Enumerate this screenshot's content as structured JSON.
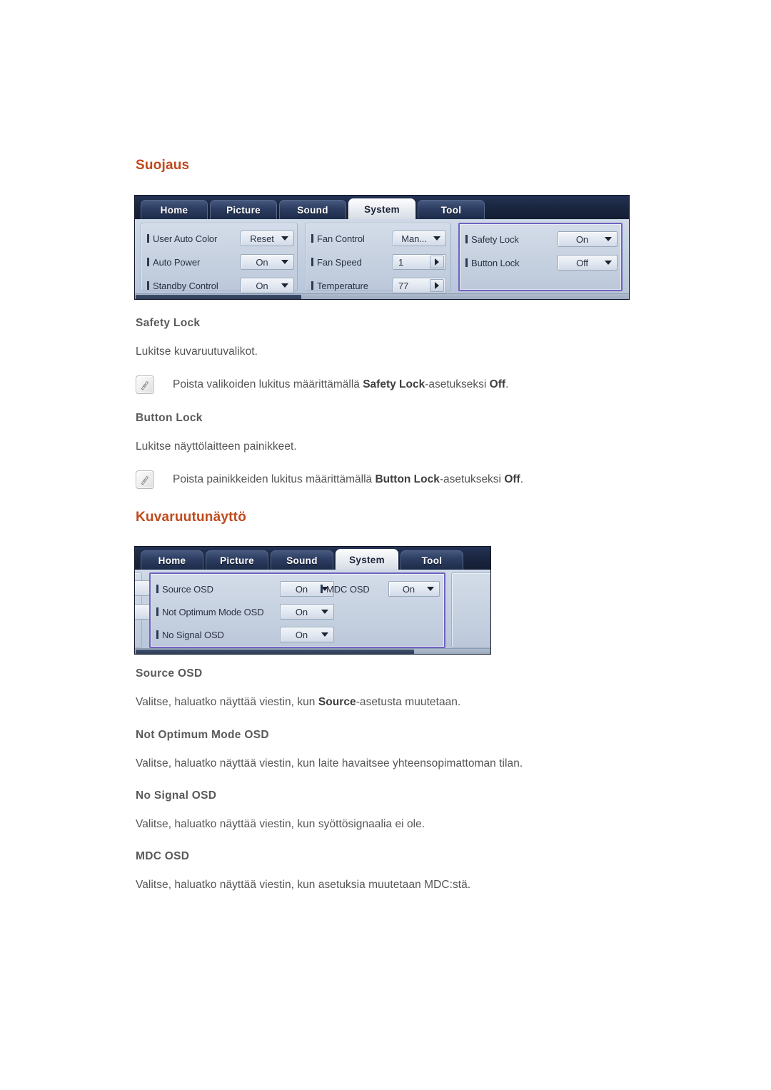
{
  "sections": [
    {
      "id": "suojaus",
      "heading": "Suojaus",
      "subsections": [
        {
          "title": "Safety Lock",
          "body": "Lukitse kuvaruutuvalikot.",
          "note_prefix": "Poista valikoiden lukitus määrittämällä ",
          "note_bold1": "Safety Lock",
          "note_mid": "-asetukseksi ",
          "note_bold2": "Off",
          "note_suffix": "."
        },
        {
          "title": "Button Lock",
          "body": "Lukitse näyttölaitteen painikkeet.",
          "note_prefix": "Poista painikkeiden lukitus määrittämällä ",
          "note_bold1": "Button Lock",
          "note_mid": "-asetukseksi ",
          "note_bold2": "Off",
          "note_suffix": "."
        }
      ]
    },
    {
      "id": "kuvaruutunaytto",
      "heading": "Kuvaruutunäyttö",
      "subsections": [
        {
          "title": "Source OSD",
          "body_prefix": "Valitse, haluatko näyttää viestin, kun ",
          "body_bold": "Source",
          "body_suffix": "-asetusta muutetaan."
        },
        {
          "title": "Not Optimum Mode OSD",
          "body": "Valitse, haluatko näyttää viestin, kun laite havaitsee yhteensopimattoman tilan."
        },
        {
          "title": "No Signal OSD",
          "body": "Valitse, haluatko näyttää viestin, kun syöttösignaalia ei ole."
        },
        {
          "title": "MDC OSD",
          "body": "Valitse, haluatko näyttää viestin, kun asetuksia muutetaan MDC:stä."
        }
      ]
    }
  ],
  "mdc_window_1": {
    "tabs": [
      {
        "label": "Home",
        "active": false
      },
      {
        "label": "Picture",
        "active": false
      },
      {
        "label": "Sound",
        "active": false
      },
      {
        "label": "System",
        "active": true
      },
      {
        "label": "Tool",
        "active": false
      }
    ],
    "groups": [
      {
        "name": "display-group",
        "selected": false,
        "controls": [
          {
            "label": "User Auto Color",
            "value": "Reset",
            "widget": "dropdown"
          },
          {
            "label": "Auto Power",
            "value": "On",
            "widget": "dropdown"
          },
          {
            "label": "Standby Control",
            "value": "On",
            "widget": "dropdown"
          }
        ]
      },
      {
        "name": "fan-group",
        "selected": false,
        "controls": [
          {
            "label": "Fan Control",
            "value": "Man...",
            "widget": "dropdown"
          },
          {
            "label": "Fan Speed",
            "value": "1",
            "widget": "spinner"
          },
          {
            "label": "Temperature",
            "value": "77",
            "widget": "spinner"
          }
        ]
      },
      {
        "name": "lock-group",
        "selected": true,
        "controls": [
          {
            "label": "Safety Lock",
            "value": "On",
            "widget": "dropdown"
          },
          {
            "label": "Button Lock",
            "value": "Off",
            "widget": "dropdown"
          }
        ]
      }
    ]
  },
  "mdc_window_2": {
    "tabs": [
      {
        "label": "Home",
        "active": false
      },
      {
        "label": "Picture",
        "active": false
      },
      {
        "label": "Sound",
        "active": false
      },
      {
        "label": "System",
        "active": true
      },
      {
        "label": "Tool",
        "active": false
      }
    ],
    "groups": [
      {
        "name": "osd-group",
        "selected": true,
        "controls": [
          {
            "label": "Source OSD",
            "value": "On",
            "widget": "dropdown"
          },
          {
            "label": "Not Optimum Mode OSD",
            "value": "On",
            "widget": "dropdown"
          },
          {
            "label": "No Signal OSD",
            "value": "On",
            "widget": "dropdown"
          }
        ]
      },
      {
        "name": "mdc-osd-group",
        "selected": false,
        "controls": [
          {
            "label": "MDC OSD",
            "value": "On",
            "widget": "dropdown"
          }
        ]
      }
    ]
  },
  "colors": {
    "heading": "#c0491c",
    "subheading": "#5a5a5a",
    "body": "#555555",
    "selection_border": "#6f62c0",
    "tabbar": "#16203a"
  }
}
